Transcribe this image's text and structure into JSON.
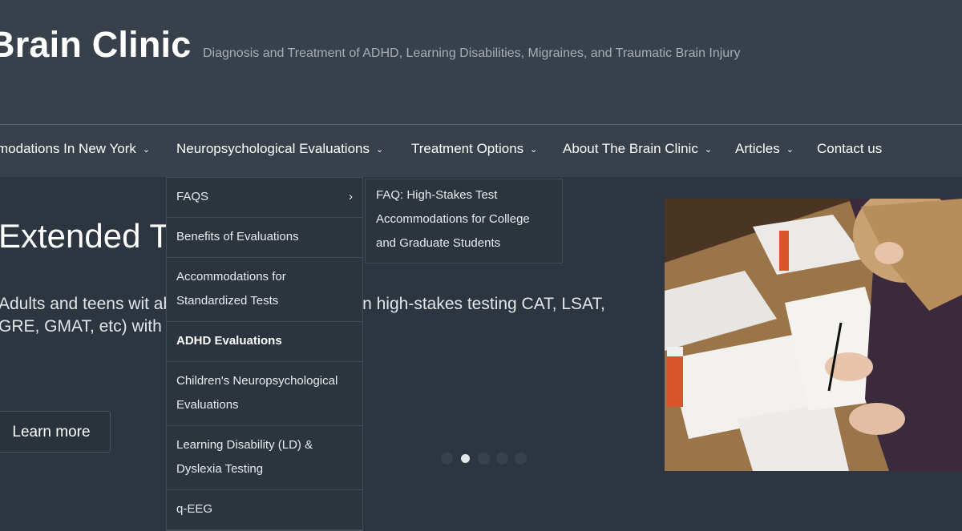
{
  "header": {
    "site_title": "Brain Clinic",
    "tagline": "Diagnosis and Treatment of ADHD, Learning Disabilities, Migraines, and Traumatic Brain Injury"
  },
  "nav": {
    "items": [
      {
        "label": "modations In New York",
        "chevron": "⌄"
      },
      {
        "label": "Neuropsychological Evaluations",
        "chevron": "⌄"
      },
      {
        "label": "Treatment Options",
        "chevron": "⌄"
      },
      {
        "label": "About The Brain Clinic",
        "chevron": "⌄"
      },
      {
        "label": "Articles",
        "chevron": "⌄"
      },
      {
        "label": "Contact us"
      }
    ]
  },
  "dropdown": {
    "items": [
      {
        "label": "FAQS",
        "arrow": "›"
      },
      {
        "label": "Benefits of Evaluations"
      },
      {
        "label": "Accommodations for Standardized Tests"
      },
      {
        "label": "ADHD Evaluations"
      },
      {
        "label": "Children's Neuropsychological Evaluations"
      },
      {
        "label": "Learning Disability (LD) & Dyslexia Testing"
      },
      {
        "label": "q-EEG"
      }
    ],
    "submenu": {
      "items": [
        {
          "label": "FAQ: High-Stakes Test Accommodations for College and Graduate Students"
        }
      ]
    }
  },
  "hero": {
    "title": "Extended T Exams",
    "text": "Adults and teens wit able to gain additional time in high-stakes testing CAT, LSAT, GRE, GMAT, etc) with the right docume",
    "button_label": "Learn more",
    "slides": {
      "count": 5,
      "active_index": 1
    },
    "photo_icon": "student-writing-photo"
  },
  "colors": {
    "header_bg": "#38414b",
    "body_bg": "#2d3640",
    "dropdown_bg": "#2c343d",
    "text": "#ffffff",
    "tagline": "#a7adb4"
  }
}
